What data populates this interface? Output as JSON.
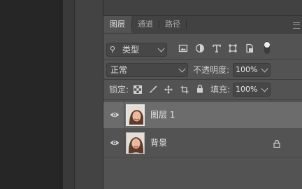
{
  "tabs": [
    {
      "label": "图层",
      "active": true
    },
    {
      "label": "通道",
      "active": false
    },
    {
      "label": "路径",
      "active": false
    }
  ],
  "filter": {
    "search_glyph": "⚲",
    "kind_label": "类型",
    "icons": [
      "image-filter-icon",
      "adjustment-filter-icon",
      "type-filter-icon",
      "shape-filter-icon",
      "smart-object-filter-icon",
      "filter-toggle-icon"
    ]
  },
  "blend": {
    "mode": "正常",
    "opacity_label": "不透明度:",
    "opacity_value": "100%"
  },
  "lock": {
    "label": "锁定:",
    "fill_label": "填充:",
    "fill_value": "100%"
  },
  "layers": [
    {
      "name": "图层 1",
      "selected": true,
      "locked": false
    },
    {
      "name": "背景",
      "selected": false,
      "locked": true
    }
  ],
  "colors": {
    "panel_bg": "#535353",
    "selected_layer": "#6c6c6c"
  }
}
